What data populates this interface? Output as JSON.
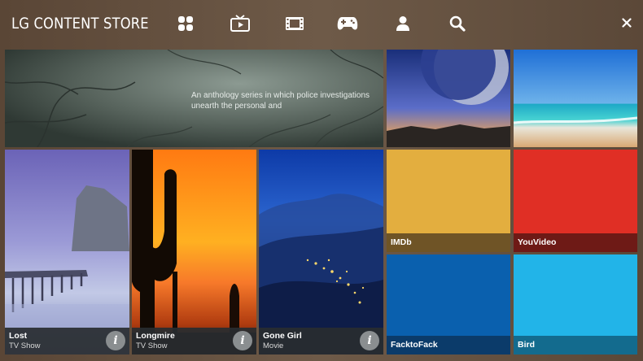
{
  "app": {
    "title": "LG CONTENT STORE"
  },
  "nav": {
    "items": [
      {
        "icon": "apps-grid-icon"
      },
      {
        "icon": "tv-icon"
      },
      {
        "icon": "film-icon"
      },
      {
        "icon": "gamepad-icon"
      },
      {
        "icon": "user-icon"
      },
      {
        "icon": "search-icon"
      }
    ],
    "close_label": "×"
  },
  "hero": {
    "description": "An anthology series in which police investigations unearth the personal and"
  },
  "media": [
    {
      "title": "Lost",
      "subtitle": "TV Show",
      "info_label": "i"
    },
    {
      "title": "Longmire",
      "subtitle": "TV Show",
      "info_label": "i"
    },
    {
      "title": "Gone Girl",
      "subtitle": "Movie",
      "info_label": "i"
    }
  ],
  "apps": [
    {
      "label": "IMDb",
      "color": "#e3ae3f",
      "label_bg": "#6f5426"
    },
    {
      "label": "YouVideo",
      "color": "#e02f25",
      "label_bg": "#6e1a16"
    },
    {
      "label": "FacktoFack",
      "color": "#0a60ae",
      "label_bg": "#0b3b6a"
    },
    {
      "label": "Bird",
      "color": "#22b4e8",
      "label_bg": "#136b8e"
    }
  ],
  "colors": {
    "background": "#6a5444",
    "caption_bg": "#282c30"
  }
}
